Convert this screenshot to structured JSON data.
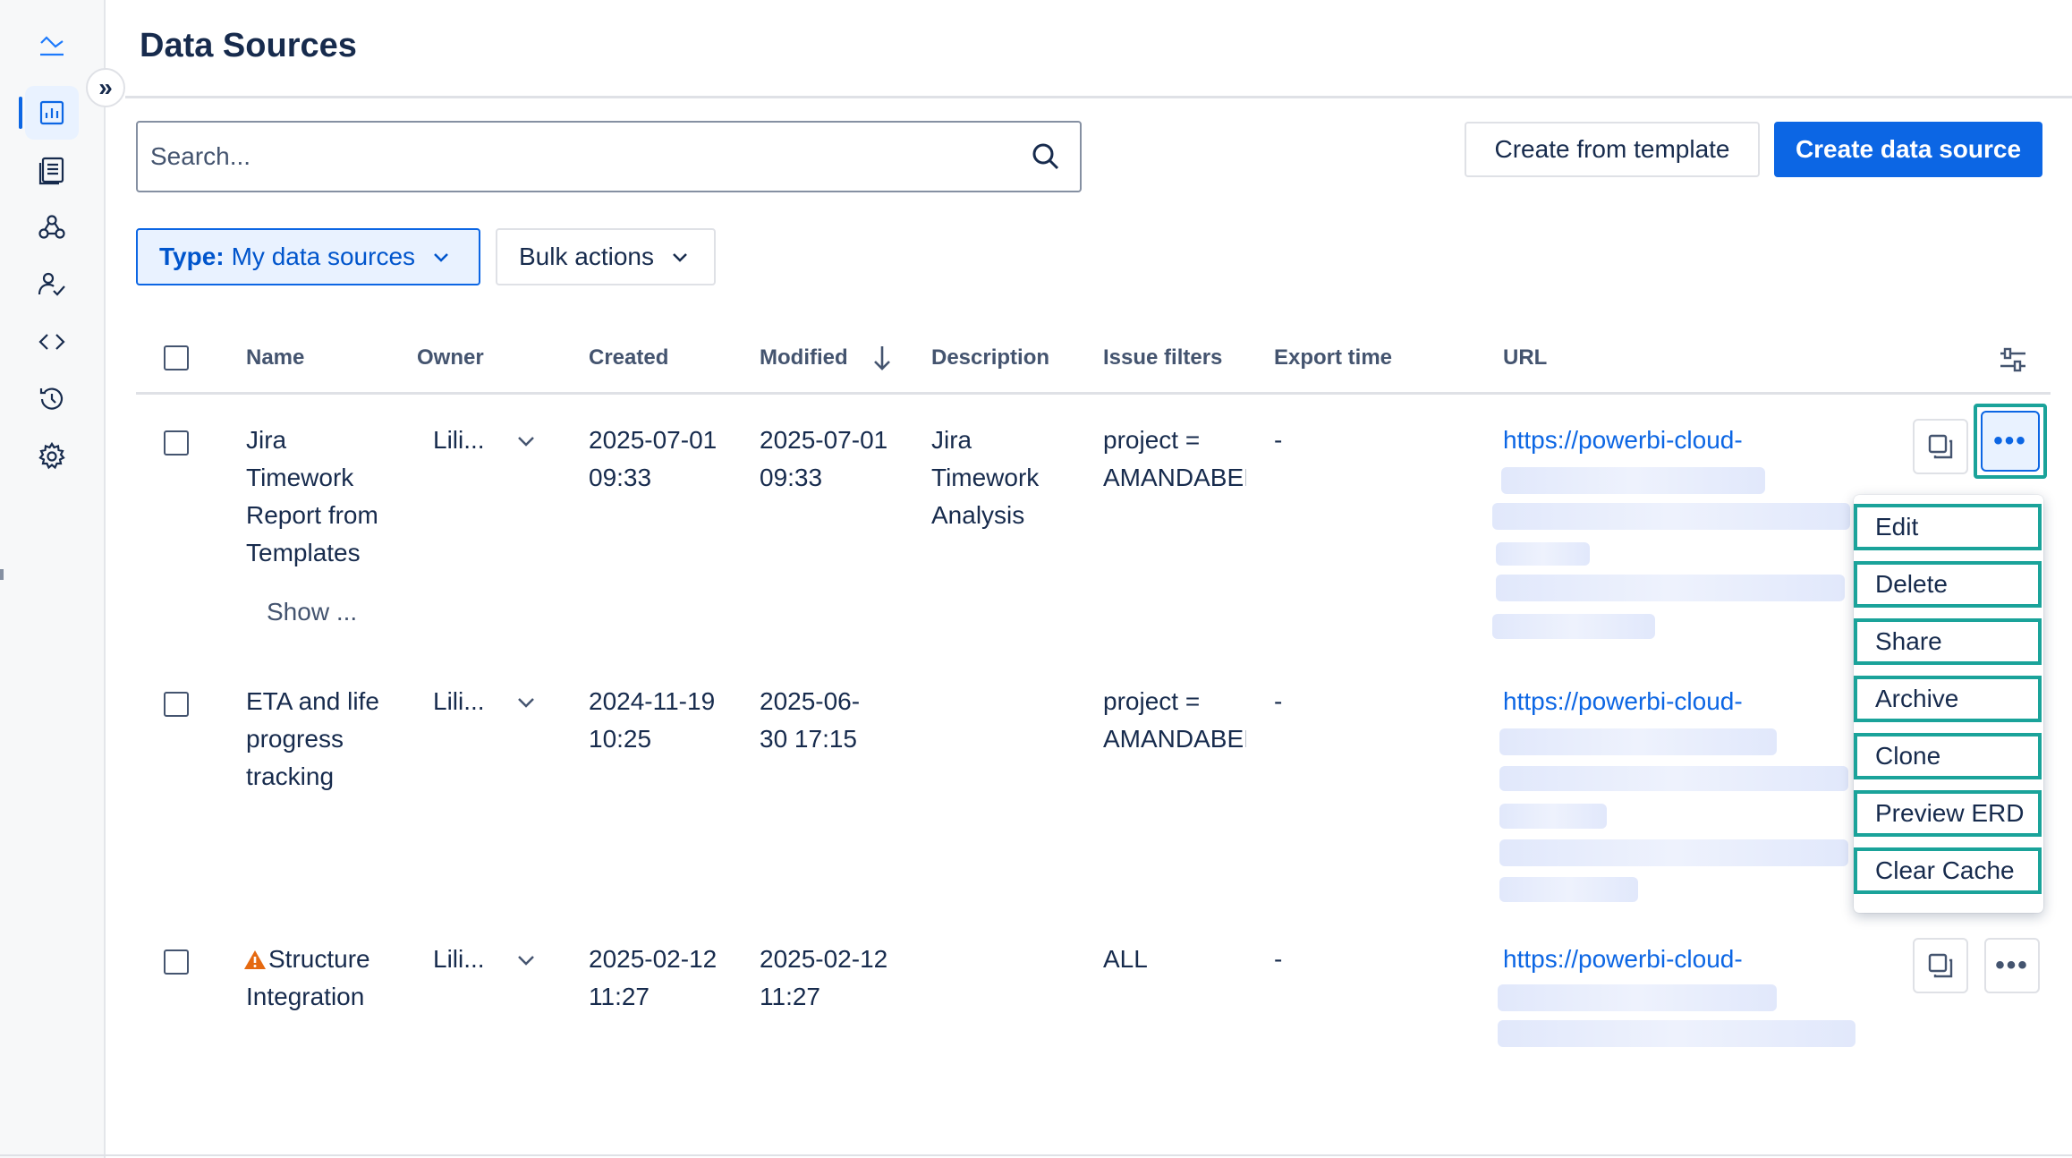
{
  "page": {
    "title": "Data Sources"
  },
  "sidebar": {
    "icons": [
      "logo-icon",
      "reports-icon",
      "document-icon",
      "webhook-icon",
      "user-check-icon",
      "code-icon",
      "history-icon",
      "settings-icon"
    ]
  },
  "toolbar": {
    "search_placeholder": "Search...",
    "create_template_label": "Create from template",
    "create_data_source_label": "Create data source",
    "type_filter_prefix": "Type:",
    "type_filter_value": "My data sources",
    "bulk_actions_label": "Bulk actions"
  },
  "table": {
    "columns": [
      "Name",
      "Owner",
      "Created",
      "Modified",
      "Description",
      "Issue filters",
      "Export time",
      "URL"
    ],
    "rows": [
      {
        "name": [
          "Jira",
          "Timework",
          "Report from",
          "Templates"
        ],
        "show_more": "Show ...",
        "owner": "Lili...",
        "created": [
          "2025-07-01",
          "09:33"
        ],
        "modified": [
          "2025-07-01",
          "09:33"
        ],
        "description": [
          "Jira",
          "Timework",
          "Analysis"
        ],
        "issue_filters": [
          "project =",
          "AMANDABEI"
        ],
        "export_time": "-",
        "url": "https://powerbi-cloud-"
      },
      {
        "name": [
          "ETA and life",
          "progress",
          "tracking"
        ],
        "owner": "Lili...",
        "created": [
          "2024-11-19",
          "10:25"
        ],
        "modified": [
          "2025-06-",
          "30 17:15"
        ],
        "description": [],
        "issue_filters": [
          "project =",
          "AMANDABEI"
        ],
        "export_time": "-",
        "url": "https://powerbi-cloud-"
      },
      {
        "name": [
          "Structure",
          "Integration"
        ],
        "owner": "Lili...",
        "created": [
          "2025-02-12",
          "11:27"
        ],
        "modified": [
          "2025-02-12",
          "11:27"
        ],
        "description": [],
        "issue_filters": [
          "ALL"
        ],
        "export_time": "-",
        "url": "https://powerbi-cloud-"
      }
    ]
  },
  "menu": {
    "items": [
      "Edit",
      "Delete",
      "Share",
      "Archive",
      "Clone",
      "Preview ERD",
      "Clear Cache"
    ]
  },
  "colors": {
    "accent": "#0c66e4",
    "highlight": "#1aa39a",
    "warning": "#e56910"
  }
}
